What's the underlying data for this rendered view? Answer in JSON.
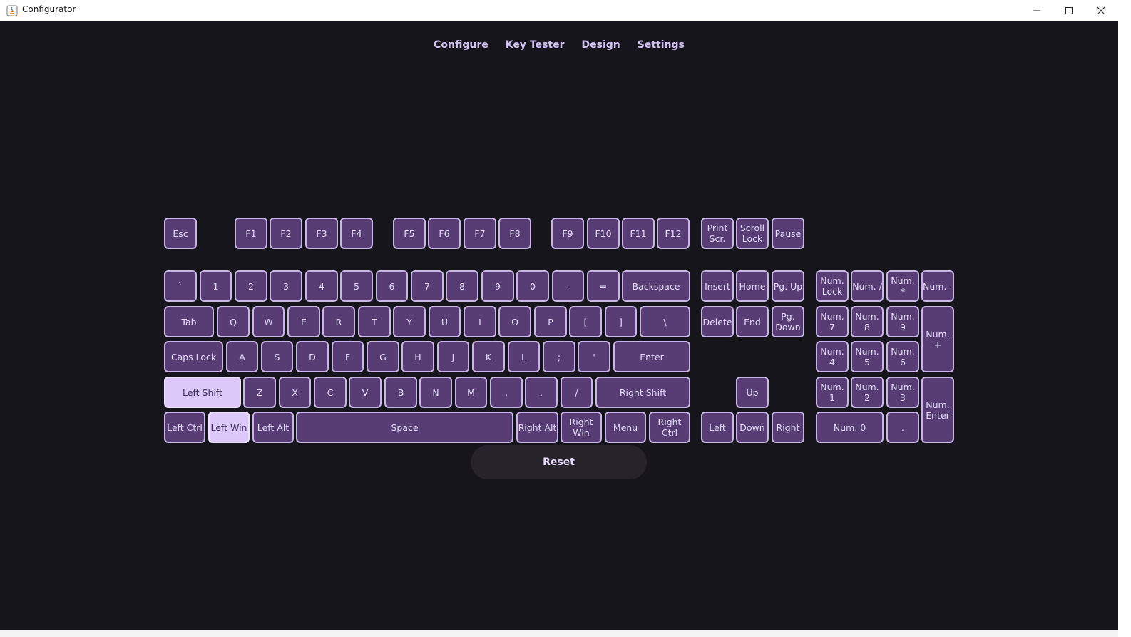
{
  "window": {
    "title": "Configurator",
    "icon": "java-app-icon",
    "controls": {
      "minimize": "minimize-icon",
      "maximize": "maximize-icon",
      "close": "close-icon"
    }
  },
  "nav": {
    "items": [
      {
        "label": "Configure"
      },
      {
        "label": "Key Tester"
      },
      {
        "label": "Design"
      },
      {
        "label": "Settings"
      }
    ]
  },
  "keyboard": {
    "keys": {
      "esc": "Esc",
      "f1": "F1",
      "f2": "F2",
      "f3": "F3",
      "f4": "F4",
      "f5": "F5",
      "f6": "F6",
      "f7": "F7",
      "f8": "F8",
      "f9": "F9",
      "f10": "F10",
      "f11": "F11",
      "f12": "F12",
      "print_scr": "Print\nScr.",
      "scroll_lock": "Scroll\nLock",
      "pause": "Pause",
      "backtick": "`",
      "d1": "1",
      "d2": "2",
      "d3": "3",
      "d4": "4",
      "d5": "5",
      "d6": "6",
      "d7": "7",
      "d8": "8",
      "d9": "9",
      "d0": "0",
      "minus": "-",
      "equals": "=",
      "backspace": "Backspace",
      "insert": "Insert",
      "home": "Home",
      "pg_up": "Pg. Up",
      "num_lock": "Num.\nLock",
      "num_slash": "Num. /",
      "num_star": "Num. *",
      "num_minus": "Num. -",
      "tab": "Tab",
      "q": "Q",
      "w": "W",
      "e": "E",
      "r": "R",
      "t": "T",
      "y": "Y",
      "u": "U",
      "i": "I",
      "o": "O",
      "p": "P",
      "lbracket": "[",
      "rbracket": "]",
      "backslash": "\\",
      "delete": "Delete",
      "end": "End",
      "pg_down": "Pg.\nDown",
      "num7": "Num. 7",
      "num8": "Num. 8",
      "num9": "Num. 9",
      "num_plus": "Num. +",
      "caps_lock": "Caps Lock",
      "a": "A",
      "s": "S",
      "d": "D",
      "f": "F",
      "g": "G",
      "h": "H",
      "j": "J",
      "k": "K",
      "l": "L",
      "semicolon": ";",
      "quote": "'",
      "enter": "Enter",
      "num4": "Num. 4",
      "num5": "Num. 5",
      "num6": "Num. 6",
      "left_shift": "Left Shift",
      "z": "Z",
      "x": "X",
      "c": "C",
      "v": "V",
      "b": "B",
      "n": "N",
      "m": "M",
      "comma": ",",
      "period": ".",
      "slash": "/",
      "right_shift": "Right Shift",
      "up": "Up",
      "num1": "Num. 1",
      "num2": "Num. 2",
      "num3": "Num. 3",
      "num_enter": "Num.\nEnter",
      "left_ctrl": "Left Ctrl",
      "left_win": "Left Win",
      "left_alt": "Left Alt",
      "space": "Space",
      "right_alt": "Right Alt",
      "right_win": "Right Win",
      "menu": "Menu",
      "right_ctrl": "Right Ctrl",
      "left": "Left",
      "down": "Down",
      "right": "Right",
      "num0": "Num. 0",
      "num_dot": "."
    },
    "pressed": [
      "left_shift",
      "left_win"
    ]
  },
  "reset": {
    "label": "Reset"
  },
  "colors": {
    "background": "#17151c",
    "key_fill": "#573d74",
    "key_border": "#c8b6e6",
    "key_pressed": "#dcc9fa",
    "nav_text": "#d3c3f5"
  }
}
